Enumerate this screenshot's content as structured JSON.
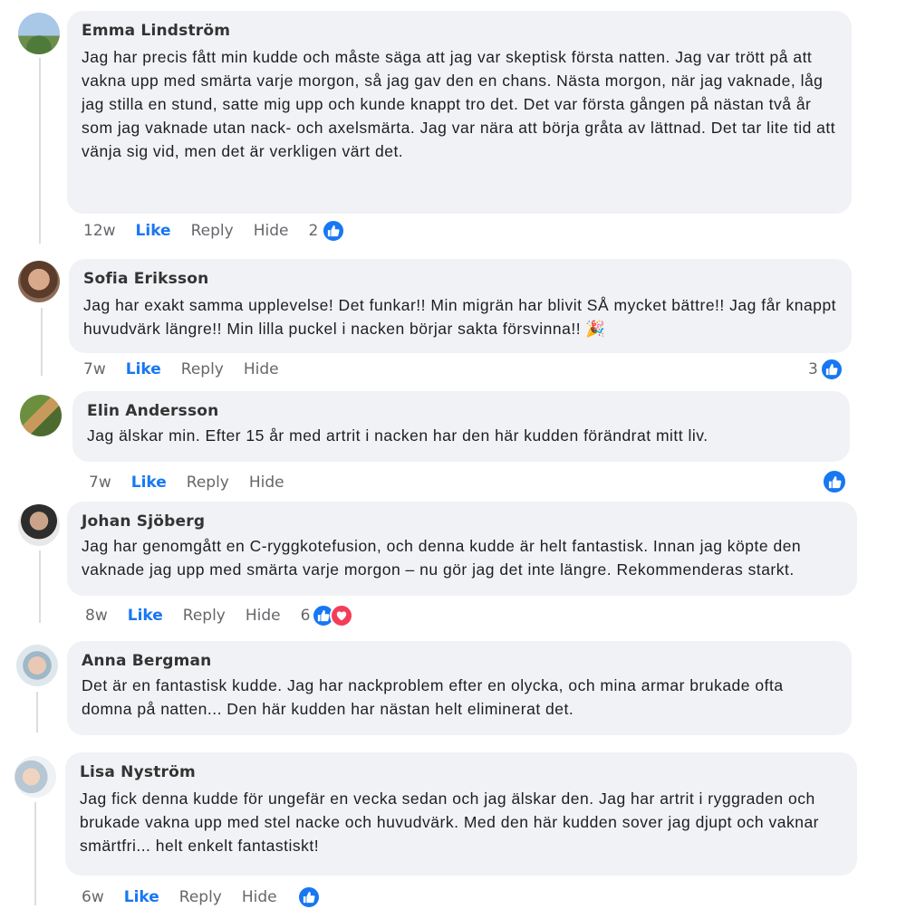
{
  "comments": [
    {
      "name": "Emma Lindström",
      "text": "Jag har precis fått min kudde och måste säga att jag var skeptisk första natten. Jag var trött på att vakna upp med smärta varje morgon, så jag gav den en chans. Nästa morgon, när jag vaknade, låg jag stilla en stund, satte mig upp och kunde knappt tro det. Det var första gången på nästan två år som jag vaknade utan nack- och axelsmärta. Jag var nära att börja gråta av lättnad. Det tar lite tid att vänja sig vid, men det är verkligen värt det.",
      "time": "12w",
      "like": "Like",
      "reply": "Reply",
      "hide": "Hide",
      "reaction_count": "2",
      "reactions": [
        "like-icon"
      ]
    },
    {
      "name": "Sofia Eriksson",
      "text": "Jag har exakt samma upplevelse! Det funkar!! Min migrän har blivit SÅ mycket bättre!! Jag får knappt huvudvärk längre!! Min lilla puckel i nacken börjar sakta försvinna!! 🎉",
      "time": "7w",
      "like": "Like",
      "reply": "Reply",
      "hide": "Hide",
      "reaction_count": "3",
      "reactions": [
        "like-icon"
      ]
    },
    {
      "name": "Elin Andersson",
      "text": "Jag älskar min. Efter 15 år med artrit i nacken har den här kudden förändrat mitt liv.",
      "time": "7w",
      "like": "Like",
      "reply": "Reply",
      "hide": "Hide",
      "reaction_count": "",
      "reactions": [
        "like-icon"
      ]
    },
    {
      "name": "Johan Sjöberg",
      "text": "Jag har genomgått en C-ryggkotefusion, och denna kudde är helt fantastisk. Innan jag köpte den vaknade jag upp med smärta varje morgon – nu gör jag det inte längre. Rekommenderas starkt.",
      "time": "8w",
      "like": "Like",
      "reply": "Reply",
      "hide": "Hide",
      "reaction_count": "6",
      "reactions": [
        "like-icon",
        "heart-icon"
      ]
    },
    {
      "name": "Anna Bergman",
      "text": "Det är en fantastisk kudde. Jag har nackproblem efter en olycka, och mina armar brukade ofta domna på natten... Den här kudden har nästan helt eliminerat det.",
      "time": "",
      "like": "",
      "reply": "",
      "hide": "",
      "reaction_count": "",
      "reactions": []
    },
    {
      "name": "Lisa Nyström",
      "text": "Jag fick denna kudde för ungefär en vecka sedan och jag älskar den. Jag har artrit i ryggraden och brukade vakna upp med stel nacke och huvudvärk. Med den här kudden sover jag djupt och vaknar smärtfri... helt enkelt fantastiskt!",
      "time": "6w",
      "like": "Like",
      "reply": "Reply",
      "hide": "Hide",
      "reaction_count": "",
      "reactions": [
        "like-icon"
      ]
    }
  ],
  "colors": {
    "bubble": "#f0f2f5",
    "like_blue": "#1877f2",
    "muted": "#65676b",
    "heart": "#f33e58"
  }
}
